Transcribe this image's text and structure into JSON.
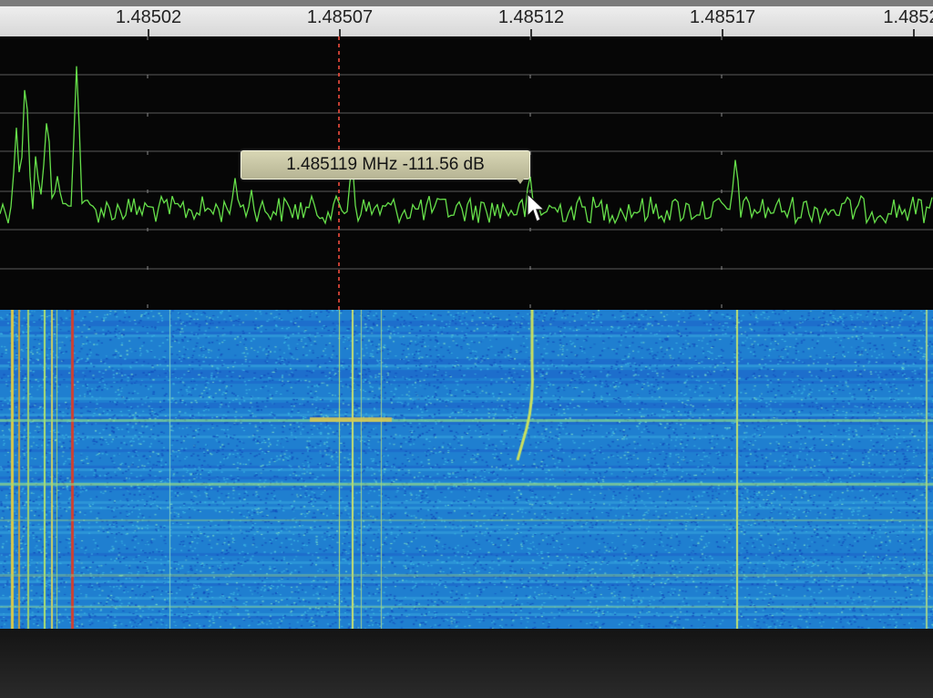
{
  "ruler": {
    "ticks": [
      "1.48502",
      "1.48507",
      "1.48512",
      "1.48517",
      "1.4852"
    ]
  },
  "readout": {
    "frequency": "1.485119 MHz",
    "level": "-111.56 dB",
    "text": "1.485119 MHz -111.56 dB"
  },
  "colors": {
    "trace": "#66e04a",
    "marker": "#ff5040",
    "grid": "#6a6a6a",
    "ruler_bg": "#e6e6e6",
    "readout_bg": "#cbc9a8",
    "waterfall_base": "#1e82d4"
  },
  "icons": {
    "cursor": "mouse-pointer-icon"
  }
}
